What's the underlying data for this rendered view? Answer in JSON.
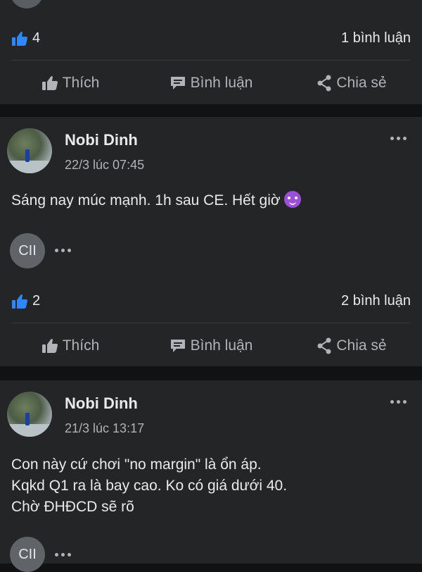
{
  "top_post": {
    "like_count": "4",
    "comment_count": "1 bình luận",
    "actions": {
      "like": "Thích",
      "comment": "Bình luận",
      "share": "Chia sẻ"
    }
  },
  "post1": {
    "author": "Nobi Dinh",
    "time": "22/3 lúc 07:45",
    "text": "Sáng nay múc mạnh. 1h sau CE. Hết giờ",
    "emoji": "smiling-devil-emoji",
    "reactor_initials": "CII",
    "like_count": "2",
    "comment_count": "2 bình luận",
    "actions": {
      "like": "Thích",
      "comment": "Bình luận",
      "share": "Chia sẻ"
    }
  },
  "post2": {
    "author": "Nobi Dinh",
    "time": "21/3 lúc 13:17",
    "text": "Con này cứ chơi \"no margin\" là ổn áp.\nKqkd Q1 ra là bay cao. Ko có giá dưới 40.\nChờ ĐHĐCD sẽ rõ",
    "reactor_initials": "CII"
  },
  "colors": {
    "background": "#242526",
    "separator": "#111214",
    "like_blue": "#2d88ff",
    "text": "#e9eaeb",
    "muted": "#b0b3b8"
  }
}
